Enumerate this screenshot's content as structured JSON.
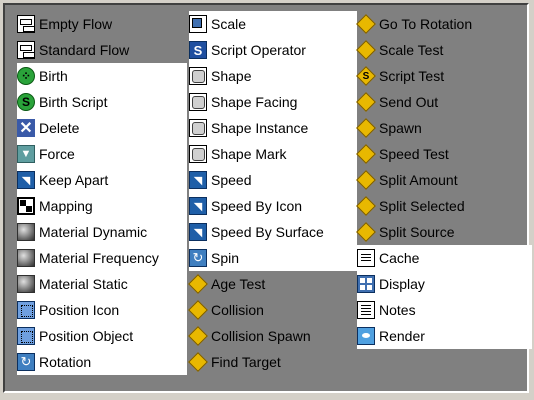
{
  "columns": [
    {
      "items": [
        {
          "label": "Empty Flow",
          "icon": "flow-icon",
          "style": "ic-flow",
          "glyph": "",
          "white": false
        },
        {
          "label": "Standard Flow",
          "icon": "flow-icon",
          "style": "ic-flow",
          "glyph": "",
          "white": false
        },
        {
          "label": "Birth",
          "icon": "birth-icon",
          "style": "ic-circle",
          "glyph": "⁘",
          "white": true
        },
        {
          "label": "Birth Script",
          "icon": "birth-script-icon",
          "style": "ic-circle",
          "glyph": "S",
          "white": true
        },
        {
          "label": "Delete",
          "icon": "delete-icon",
          "style": "ic-delete",
          "glyph": "✕",
          "white": true
        },
        {
          "label": "Force",
          "icon": "force-icon",
          "style": "ic-force",
          "glyph": "▼",
          "white": true
        },
        {
          "label": "Keep Apart",
          "icon": "keep-apart-icon",
          "style": "ic-speed",
          "glyph": "◥",
          "white": true
        },
        {
          "label": "Mapping",
          "icon": "mapping-icon",
          "style": "ic-map",
          "glyph": "",
          "white": true
        },
        {
          "label": "Material Dynamic",
          "icon": "material-dynamic-icon",
          "style": "ic-mat",
          "glyph": "",
          "white": true
        },
        {
          "label": "Material Frequency",
          "icon": "material-frequency-icon",
          "style": "ic-mat",
          "glyph": "",
          "white": true
        },
        {
          "label": "Material Static",
          "icon": "material-static-icon",
          "style": "ic-mat",
          "glyph": "",
          "white": true
        },
        {
          "label": "Position Icon",
          "icon": "position-icon-icon",
          "style": "ic-pos",
          "glyph": "",
          "white": true
        },
        {
          "label": "Position Object",
          "icon": "position-object-icon",
          "style": "ic-pos",
          "glyph": "",
          "white": true
        },
        {
          "label": "Rotation",
          "icon": "rotation-icon",
          "style": "ic-rot",
          "glyph": "↻",
          "white": true
        }
      ]
    },
    {
      "items": [
        {
          "label": "Scale",
          "icon": "scale-icon",
          "style": "ic-scale",
          "glyph": "",
          "white": true
        },
        {
          "label": "Script Operator",
          "icon": "script-operator-icon",
          "style": "ic-script",
          "glyph": "S",
          "white": true
        },
        {
          "label": "Shape",
          "icon": "shape-icon",
          "style": "ic-shape",
          "glyph": "",
          "white": true
        },
        {
          "label": "Shape Facing",
          "icon": "shape-facing-icon",
          "style": "ic-shape",
          "glyph": "",
          "white": true
        },
        {
          "label": "Shape Instance",
          "icon": "shape-instance-icon",
          "style": "ic-shape",
          "glyph": "",
          "white": true
        },
        {
          "label": "Shape Mark",
          "icon": "shape-mark-icon",
          "style": "ic-shape",
          "glyph": "",
          "white": true
        },
        {
          "label": "Speed",
          "icon": "speed-icon",
          "style": "ic-speed",
          "glyph": "◥",
          "white": true
        },
        {
          "label": "Speed By Icon",
          "icon": "speed-by-icon-icon",
          "style": "ic-speed",
          "glyph": "◥",
          "white": true
        },
        {
          "label": "Speed By Surface",
          "icon": "speed-by-surface-icon",
          "style": "ic-speed",
          "glyph": "◥",
          "white": true
        },
        {
          "label": "Spin",
          "icon": "spin-icon",
          "style": "ic-rot",
          "glyph": "↻",
          "white": true
        },
        {
          "label": "Age Test",
          "icon": "age-test-icon",
          "style": "ic-diamond",
          "glyph": "",
          "white": false
        },
        {
          "label": "Collision",
          "icon": "collision-icon",
          "style": "ic-diamond",
          "glyph": "",
          "white": false
        },
        {
          "label": "Collision Spawn",
          "icon": "collision-spawn-icon",
          "style": "ic-diamond",
          "glyph": "",
          "white": false
        },
        {
          "label": "Find Target",
          "icon": "find-target-icon",
          "style": "ic-diamond",
          "glyph": "",
          "white": false
        }
      ]
    },
    {
      "items": [
        {
          "label": "Go To Rotation",
          "icon": "go-to-rotation-icon",
          "style": "ic-diamond",
          "glyph": "",
          "white": false
        },
        {
          "label": "Scale Test",
          "icon": "scale-test-icon",
          "style": "ic-diamond",
          "glyph": "",
          "white": false
        },
        {
          "label": "Script Test",
          "icon": "script-test-icon",
          "style": "ic-diamond",
          "glyph": "S",
          "white": false
        },
        {
          "label": "Send Out",
          "icon": "send-out-icon",
          "style": "ic-diamond",
          "glyph": "",
          "white": false
        },
        {
          "label": "Spawn",
          "icon": "spawn-icon",
          "style": "ic-diamond",
          "glyph": "",
          "white": false
        },
        {
          "label": "Speed Test",
          "icon": "speed-test-icon",
          "style": "ic-diamond",
          "glyph": "",
          "white": false
        },
        {
          "label": "Split Amount",
          "icon": "split-amount-icon",
          "style": "ic-diamond",
          "glyph": "",
          "white": false
        },
        {
          "label": "Split Selected",
          "icon": "split-selected-icon",
          "style": "ic-diamond",
          "glyph": "",
          "white": false
        },
        {
          "label": "Split Source",
          "icon": "split-source-icon",
          "style": "ic-diamond",
          "glyph": "",
          "white": false
        },
        {
          "label": "Cache",
          "icon": "cache-icon",
          "style": "ic-cache",
          "glyph": "",
          "white": true
        },
        {
          "label": "Display",
          "icon": "display-icon",
          "style": "ic-display",
          "glyph": "",
          "white": true
        },
        {
          "label": "Notes",
          "icon": "notes-icon",
          "style": "ic-notes",
          "glyph": "",
          "white": true
        },
        {
          "label": "Render",
          "icon": "render-icon",
          "style": "ic-render",
          "glyph": "",
          "white": true
        }
      ]
    }
  ],
  "colors": {
    "panel_background": "#808080",
    "white_item_background": "#ffffff",
    "test_diamond": "#e8b800",
    "birth_green": "#2aa33a"
  }
}
